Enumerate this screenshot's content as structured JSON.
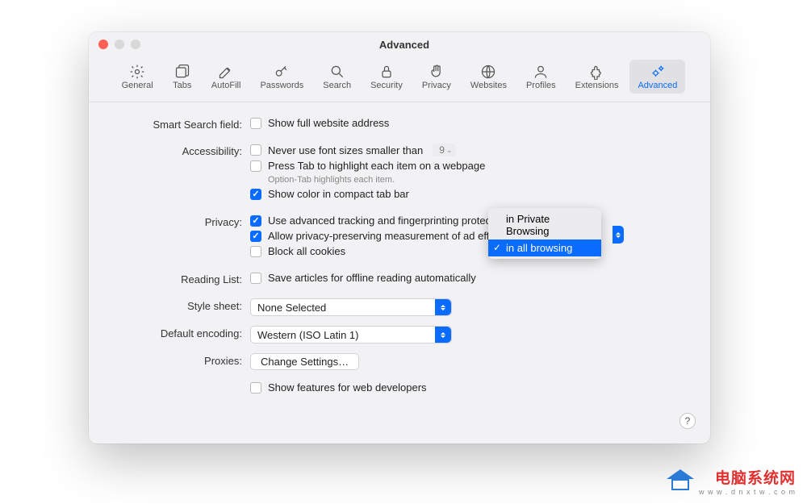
{
  "window": {
    "title": "Advanced"
  },
  "toolbar": [
    {
      "label": "General"
    },
    {
      "label": "Tabs"
    },
    {
      "label": "AutoFill"
    },
    {
      "label": "Passwords"
    },
    {
      "label": "Search"
    },
    {
      "label": "Security"
    },
    {
      "label": "Privacy"
    },
    {
      "label": "Websites"
    },
    {
      "label": "Profiles"
    },
    {
      "label": "Extensions"
    },
    {
      "label": "Advanced"
    }
  ],
  "sections": {
    "smart_search": {
      "label": "Smart Search field:",
      "show_full_address": "Show full website address"
    },
    "accessibility": {
      "label": "Accessibility:",
      "font_min": "Never use font sizes smaller than",
      "font_value": "9",
      "press_tab": "Press Tab to highlight each item on a webpage",
      "press_tab_hint": "Option-Tab highlights each item.",
      "compact_color": "Show color in compact tab bar"
    },
    "privacy": {
      "label": "Privacy:",
      "tracking": "Use advanced tracking and fingerprinting protection",
      "ad_measure": "Allow privacy-preserving measurement of ad effectiveness",
      "block_cookies": "Block all cookies"
    },
    "privacy_popup": {
      "private_browsing": "in Private Browsing",
      "all_browsing": "in all browsing"
    },
    "reading_list": {
      "label": "Reading List:",
      "save_offline": "Save articles for offline reading automatically"
    },
    "style_sheet": {
      "label": "Style sheet:",
      "value": "None Selected"
    },
    "encoding": {
      "label": "Default encoding:",
      "value": "Western (ISO Latin 1)"
    },
    "proxies": {
      "label": "Proxies:",
      "button": "Change Settings…"
    },
    "developer": {
      "show_features": "Show features for web developers"
    }
  },
  "help": "?",
  "watermark": {
    "cn": "电脑系统网",
    "url": "w w w . d n x t w . c o m"
  }
}
